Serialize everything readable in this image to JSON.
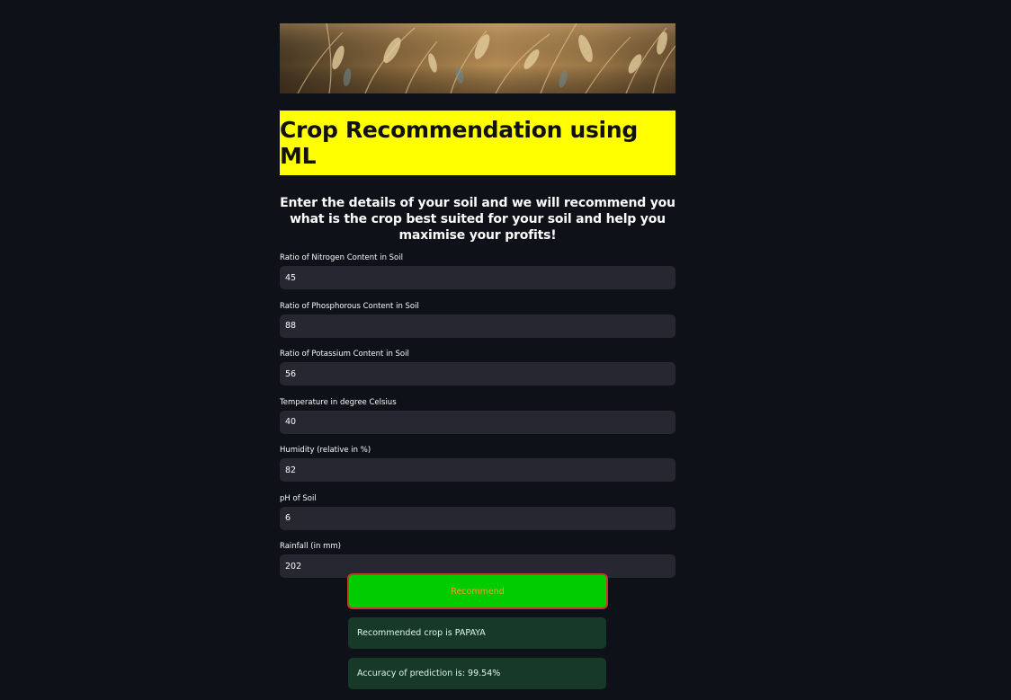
{
  "banner": {
    "image": "wheat-field-banner"
  },
  "header": {
    "title": "Crop Recommendation using ML",
    "subtitle": "Enter the details of your soil and we will recommend you what is the crop best suited for your soil and help you maximise your profits!"
  },
  "form": {
    "fields": [
      {
        "label": "Ratio of Nitrogen Content in Soil",
        "value": "45"
      },
      {
        "label": "Ratio of Phosphorous Content in Soil",
        "value": "88"
      },
      {
        "label": "Ratio of Potassium Content in Soil",
        "value": "56"
      },
      {
        "label": "Temperature in degree Celsius",
        "value": "40"
      },
      {
        "label": "Humidity (relative in %)",
        "value": "82"
      },
      {
        "label": "pH of Soil",
        "value": "6"
      },
      {
        "label": "Rainfall (in mm)",
        "value": "202"
      }
    ],
    "submit_label": "Recommend"
  },
  "results": {
    "crop_message": "Recommended crop is PAPAYA",
    "accuracy_message": "Accuracy of prediction is: 99.54%"
  },
  "colors": {
    "background": "#0e1117",
    "title_bg": "#ffff00",
    "input_bg": "#262730",
    "button_bg": "#00cc00",
    "button_border": "#c0392b",
    "button_text": "#ff9933",
    "success_bg": "#173928"
  }
}
